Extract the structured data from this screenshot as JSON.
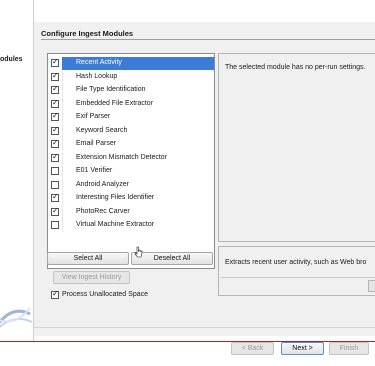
{
  "wizard": {
    "step_label": "odules"
  },
  "panel": {
    "title": "Configure Ingest Modules"
  },
  "modules": [
    {
      "label": "Recent Activity",
      "checked": true,
      "selected": true
    },
    {
      "label": "Hash Lookup",
      "checked": true,
      "selected": false
    },
    {
      "label": "File Type Identification",
      "checked": true,
      "selected": false
    },
    {
      "label": "Embedded File Extractor",
      "checked": true,
      "selected": false
    },
    {
      "label": "Exif Parser",
      "checked": true,
      "selected": false
    },
    {
      "label": "Keyword Search",
      "checked": true,
      "selected": false
    },
    {
      "label": "Email Parser",
      "checked": true,
      "selected": false
    },
    {
      "label": "Extension Mismatch Detector",
      "checked": true,
      "selected": false
    },
    {
      "label": "E01 Verifier",
      "checked": false,
      "selected": false
    },
    {
      "label": "Android Analyzer",
      "checked": false,
      "selected": false
    },
    {
      "label": "Interesting Files Identifier",
      "checked": true,
      "selected": false
    },
    {
      "label": "PhotoRec Carver",
      "checked": true,
      "selected": false
    },
    {
      "label": "Virtual Machine Extractor",
      "checked": false,
      "selected": false
    }
  ],
  "buttons": {
    "select_all": "Select All",
    "deselect_all": "Deselect All",
    "view_history": "View Ingest History",
    "back": "< Back",
    "next": "Next >",
    "finish": "Finish"
  },
  "process_unallocated": {
    "label": "Process Unallocated Space",
    "checked": true
  },
  "settings": {
    "message": "The selected module has no per-run settings."
  },
  "description": {
    "text": "Extracts recent user activity, such as Web bro"
  },
  "colors": {
    "selection": "#3c7bd6",
    "panel_bg": "#f0f0f0",
    "accent_line": "#b32020"
  }
}
